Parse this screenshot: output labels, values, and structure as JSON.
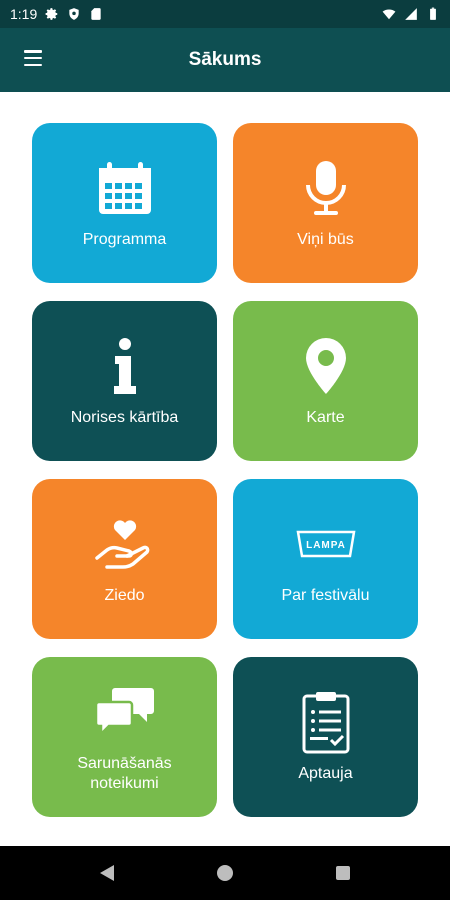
{
  "status_bar": {
    "time": "1:19"
  },
  "app_bar": {
    "title": "Sākums"
  },
  "colors": {
    "blue": "#12a9d5",
    "orange": "#f5852a",
    "dark_teal": "#0e5055",
    "green": "#78bb4c"
  },
  "tiles": [
    {
      "label": "Programma",
      "icon": "calendar-icon",
      "color": "#12a9d5"
    },
    {
      "label": "Viņi būs",
      "icon": "microphone-icon",
      "color": "#f5852a"
    },
    {
      "label": "Norises kārtība",
      "icon": "info-icon",
      "color": "#0e5055"
    },
    {
      "label": "Karte",
      "icon": "map-pin-icon",
      "color": "#78bb4c"
    },
    {
      "label": "Ziedo",
      "icon": "heart-hand-icon",
      "color": "#f5852a"
    },
    {
      "label": "Par festivālu",
      "icon": "lampa-logo-icon",
      "logo_text": "LAMPA",
      "color": "#12a9d5"
    },
    {
      "label": "Sarunāšanās noteikumi",
      "icon": "chat-bubbles-icon",
      "color": "#78bb4c"
    },
    {
      "label": "Aptauja",
      "icon": "survey-clipboard-icon",
      "color": "#0e5055"
    }
  ]
}
